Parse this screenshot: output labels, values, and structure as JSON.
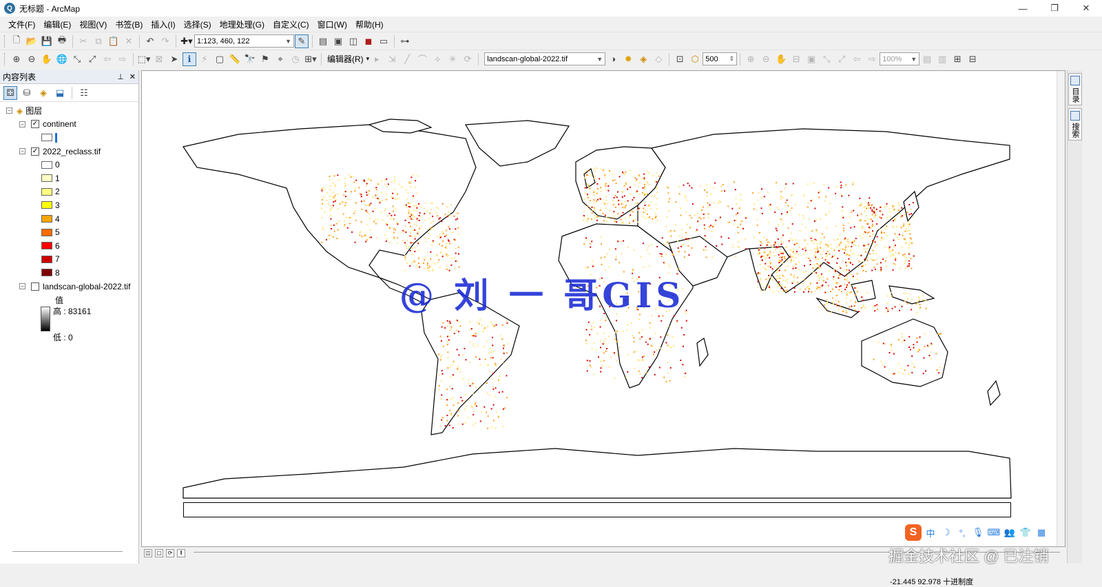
{
  "window": {
    "title": "无标题 - ArcMap",
    "minimize": "—",
    "maximize": "❐",
    "close": "✕"
  },
  "menu": [
    "文件(F)",
    "编辑(E)",
    "视图(V)",
    "书签(B)",
    "插入(I)",
    "选择(S)",
    "地理处理(G)",
    "自定义(C)",
    "窗口(W)",
    "帮助(H)"
  ],
  "toolbar": {
    "scale": "1:123, 460, 122",
    "editor_label": "编辑器(R)",
    "layer_select": "landscan-global-2022.tif",
    "resolution": "500",
    "zoom_percent": "100%"
  },
  "toc": {
    "title": "内容列表",
    "pin": "📌",
    "close": "✕",
    "root": "图层",
    "layers": [
      {
        "name": "continent",
        "checked": true
      },
      {
        "name": "2022_reclass.tif",
        "checked": true
      },
      {
        "name": "landscan-global-2022.tif",
        "checked": false
      }
    ],
    "reclass_classes": [
      {
        "label": "0",
        "color": "#ffffff"
      },
      {
        "label": "1",
        "color": "#ffffc4"
      },
      {
        "label": "2",
        "color": "#ffff80"
      },
      {
        "label": "3",
        "color": "#ffff00"
      },
      {
        "label": "4",
        "color": "#ffa500"
      },
      {
        "label": "5",
        "color": "#ff6a00"
      },
      {
        "label": "6",
        "color": "#ff0000"
      },
      {
        "label": "7",
        "color": "#cc0000"
      },
      {
        "label": "8",
        "color": "#800000"
      }
    ],
    "value_label": "值",
    "high_label": "高 : 83161",
    "low_label": "低 : 0"
  },
  "map": {
    "watermark": "@ 刘 一 哥GIS"
  },
  "right_tabs": [
    "目录",
    "搜索"
  ],
  "status": {
    "coords": "-21.445  92.978 十进制度",
    "credit": "掘金技术社区 @ 已注销"
  },
  "ime": {
    "logo": "S",
    "lang": "中"
  },
  "colors": {
    "accent": "#3c7fb1",
    "watermark": "#1a2bd6",
    "density_low": "#ffe680",
    "density_mid": "#ff9f1a",
    "density_high": "#d90000"
  }
}
